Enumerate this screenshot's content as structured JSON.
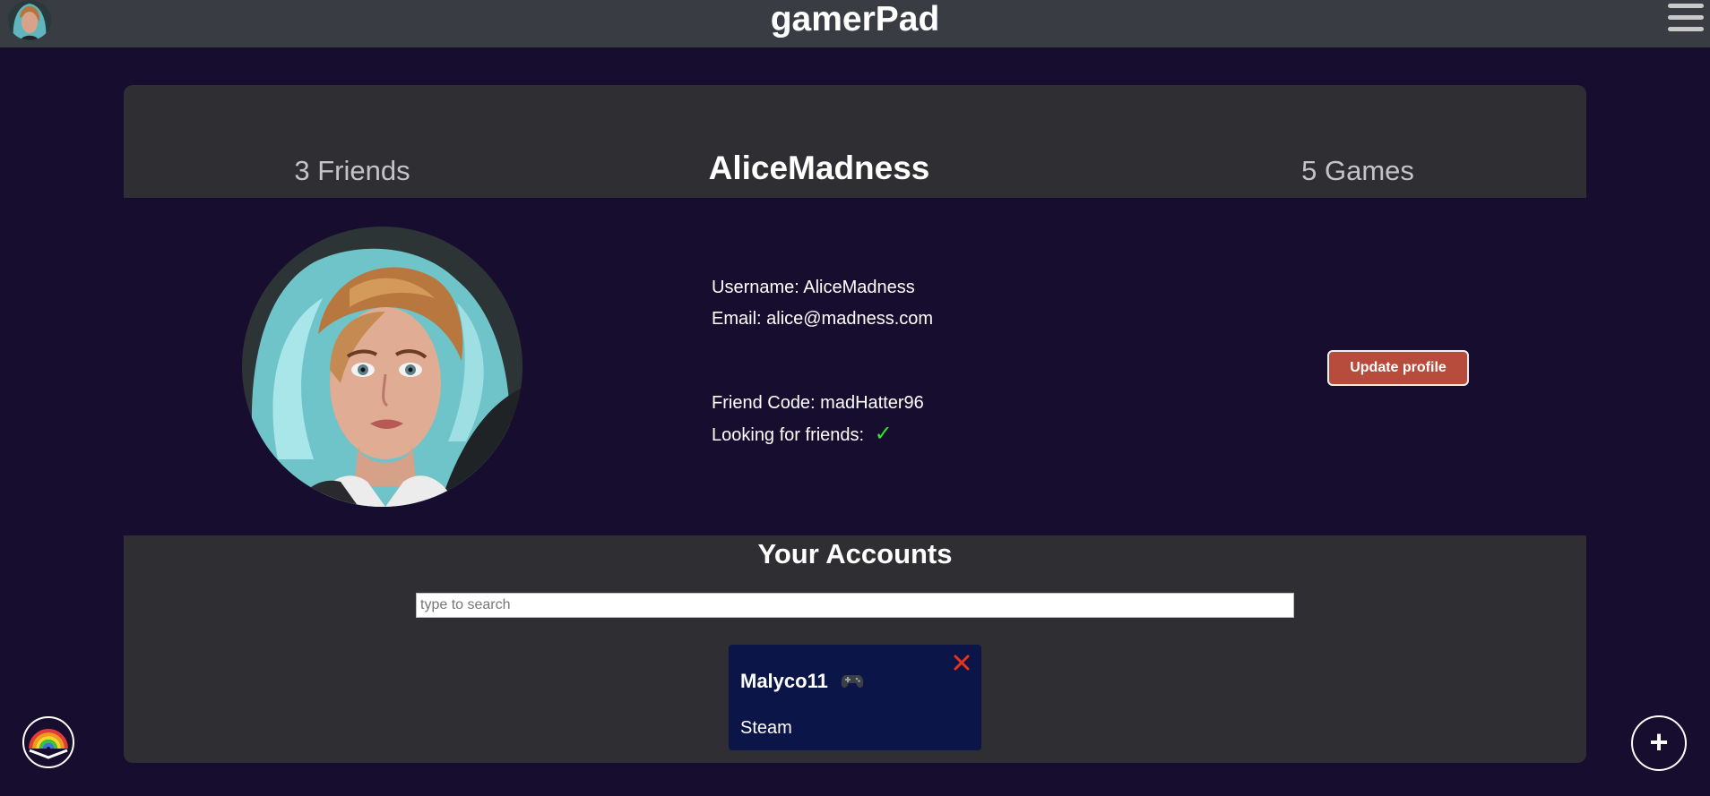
{
  "app": {
    "title": "gamerPad"
  },
  "profile": {
    "friends_label": "3 Friends",
    "name": "AliceMadness",
    "games_label": "5 Games",
    "username_line": "Username: AliceMadness",
    "email_line": "Email: alice@madness.com",
    "friend_code_line": "Friend Code: madHatter96",
    "looking_label": "Looking for friends:",
    "looking_for_friends": true,
    "update_button": "Update profile"
  },
  "accounts": {
    "title": "Your Accounts",
    "search_placeholder": "type to search",
    "search_value": "",
    "items": [
      {
        "name": "Malyco11",
        "platform": "Steam",
        "icon": "gamepad-icon"
      }
    ]
  },
  "icons": {
    "top_avatar": "avatar",
    "menu": "hamburger-menu-icon",
    "check": "checkmark-icon",
    "remove": "close-icon",
    "bottom_left": "rainbow-icon",
    "bottom_right": "plus-icon"
  },
  "colors": {
    "background": "#170d2e",
    "topbar": "#393c42",
    "card": "#2f2e33",
    "account_card": "#0c1548",
    "update_button": "#b84c3c",
    "check": "#2ee62e",
    "remove": "#e8321e"
  }
}
